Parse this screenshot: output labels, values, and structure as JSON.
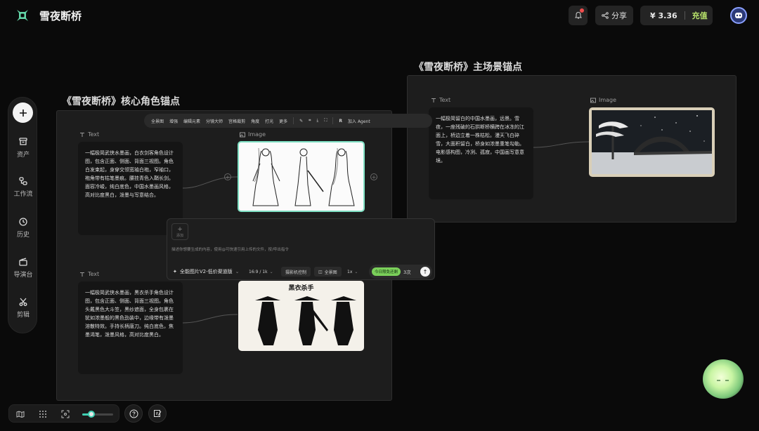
{
  "app": {
    "title": "雪夜断桥"
  },
  "header": {
    "share_label": "分享",
    "balance": "¥ 3.36",
    "topup_label": "充值"
  },
  "sidebar": {
    "items": [
      {
        "label": "资产",
        "icon": "archive-icon"
      },
      {
        "label": "工作流",
        "icon": "workflow-icon"
      },
      {
        "label": "历史",
        "icon": "clock-icon"
      },
      {
        "label": "导演台",
        "icon": "clapper-icon"
      },
      {
        "label": "剪辑",
        "icon": "scissors-icon"
      }
    ]
  },
  "frames": {
    "characters": {
      "title": "《雪夜断桥》核心角色锚点"
    },
    "scene": {
      "title": "《雪夜断桥》主场景锚点"
    }
  },
  "nodes": {
    "text_label": "Text",
    "image_label": "Image",
    "char1_text": "一幅极简武侠水墨画，白衣剑客角色设计图，包含正面、侧面、背面三视图。角色白发束起，身穿交领宽袖白袍，窄袖口，袍角带有枯笔墨痕。腰挂青色入鞘长剑。面容冷峻，纯白底色，中国水墨画风格，高对比度黑白，泼墨与写意结合。",
    "char2_text": "一幅极简武侠水墨画，黑衣杀手角色设计图，包含正面、侧面、背面三视图。角色头戴黑色大斗笠，黑纱遮面，全身包裹在犹如浓墨般的黑色劲装中，边缘带有泼墨溶散特效。手持长柄唐刀。纯白底色，焦墨渴笔，泼墨风格，高对比度黑白。",
    "scene_text": "一幅极简留白的中国水墨画，远景。雪夜，一座残破的石拱断桥横跨在冰冻的江面上，桥边立着一株枯松。漫天飞白碎雪，大面积留白，桥身如浓墨重笔勾勒。电影感构图，冷冽、孤寂，中国画写意意境。",
    "char2_image_caption": "黑衣杀手"
  },
  "toolbar": {
    "items": [
      "全景图",
      "增强",
      "编辑元素",
      "分镜大师",
      "宫格裁剪",
      "角度",
      "打光",
      "更多"
    ],
    "agent_label": "加入 Agent"
  },
  "prompt": {
    "add_label": "添加",
    "hint": "描述你想要生成的内容，使用@可快速引用上传的文件，按/呼出指令",
    "model": "全能图片V2-低价渠道版",
    "ratio": "16:9 / 1k",
    "camera": "摄影机控制",
    "panorama": "全景图",
    "count": "1x",
    "free_badge": "今日限免还剩",
    "free_count": "3次"
  },
  "bottom": {
    "zoom_fraction": 0.3
  },
  "colors": {
    "accent": "#3fd0b3",
    "topup": "#b8e36b",
    "free_badge": "#7bd05a",
    "notification": "#f04d4d",
    "selected_border": "#7fe0c4"
  }
}
